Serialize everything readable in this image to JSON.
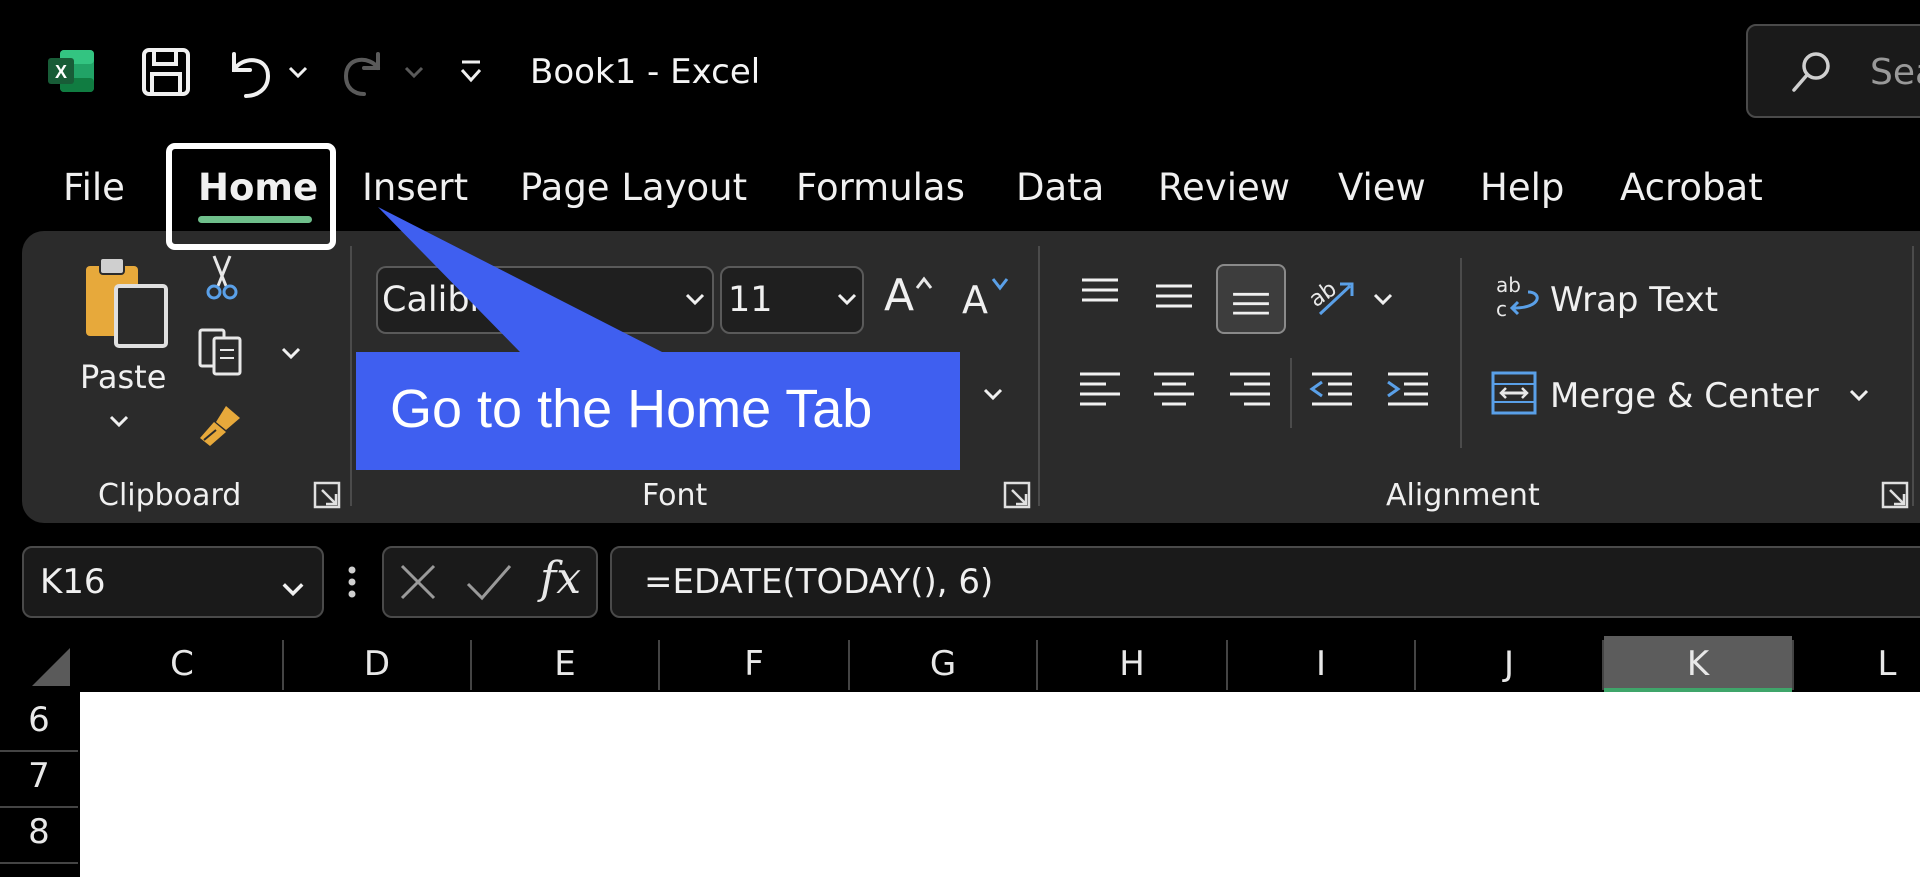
{
  "window": {
    "title": "Book1  -  Excel",
    "search_placeholder": "Sea"
  },
  "quick_access": {
    "icons": [
      "excel-logo-icon",
      "save-icon",
      "undo-icon",
      "chevron-down-icon",
      "redo-icon",
      "customize-toolbar-icon"
    ]
  },
  "tabs": [
    {
      "label": "File",
      "active": false
    },
    {
      "label": "Home",
      "active": true
    },
    {
      "label": "Insert",
      "active": false
    },
    {
      "label": "Page Layout",
      "active": false
    },
    {
      "label": "Formulas",
      "active": false
    },
    {
      "label": "Data",
      "active": false
    },
    {
      "label": "Review",
      "active": false
    },
    {
      "label": "View",
      "active": false
    },
    {
      "label": "Help",
      "active": false
    },
    {
      "label": "Acrobat",
      "active": false
    }
  ],
  "ribbon": {
    "clipboard": {
      "paste_label": "Paste",
      "group_label": "Clipboard"
    },
    "font": {
      "font_name": "Calibri",
      "font_size": "11",
      "grow_label": "A",
      "shrink_label": "A",
      "group_label": "Font"
    },
    "alignment": {
      "wrap_text_label": "Wrap Text",
      "merge_center_label": "Merge & Center",
      "group_label": "Alignment"
    }
  },
  "callout": {
    "text": "Go to the Home Tab"
  },
  "formula_bar": {
    "name_box": "K16",
    "fx_label": "fx",
    "formula": "=EDATE(TODAY(), 6)"
  },
  "grid": {
    "columns": [
      "C",
      "D",
      "E",
      "F",
      "G",
      "H",
      "I",
      "J",
      "K",
      "L"
    ],
    "selected_column": "K",
    "rows": [
      "6",
      "7",
      "8"
    ]
  },
  "colors": {
    "accent_green": "#6fbf8b",
    "callout_blue": "#3f5ff0",
    "ribbon_bg": "#2b2b2b",
    "selected_header": "#5c5c5c"
  }
}
